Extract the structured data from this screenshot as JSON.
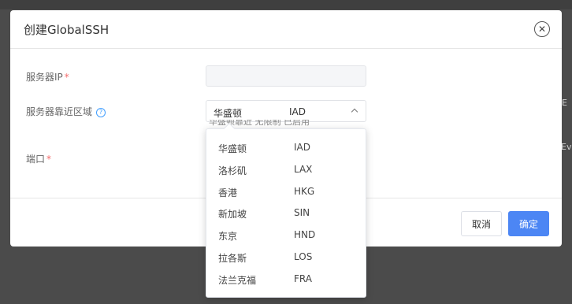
{
  "background": {
    "right_text_1": "E",
    "right_text_2": "Ev"
  },
  "dialog": {
    "title": "创建GlobalSSH",
    "close_icon": "close-circle-icon"
  },
  "form": {
    "server_ip": {
      "label": "服务器IP",
      "required": "*",
      "value": "",
      "placeholder": ""
    },
    "region": {
      "label": "服务器靠近区域",
      "help_icon": "question-circle-icon",
      "selected_name": "华盛顿",
      "selected_code": "IAD",
      "hint_partial": "华盛顿靠近   无限制   已启用"
    },
    "port": {
      "label": "端口",
      "required": "*"
    }
  },
  "dropdown": {
    "options": [
      {
        "name": "华盛顿",
        "code": "IAD"
      },
      {
        "name": "洛杉矶",
        "code": "LAX"
      },
      {
        "name": "香港",
        "code": "HKG"
      },
      {
        "name": "新加坡",
        "code": "SIN"
      },
      {
        "name": "东京",
        "code": "HND"
      },
      {
        "name": "拉各斯",
        "code": "LOS"
      },
      {
        "name": "法兰克福",
        "code": "FRA"
      }
    ]
  },
  "footer": {
    "cancel_label": "取消",
    "confirm_label": "确定"
  },
  "colors": {
    "primary": "#4c86f4",
    "required": "#f56c6c",
    "overlay": "#4b4b4b"
  }
}
